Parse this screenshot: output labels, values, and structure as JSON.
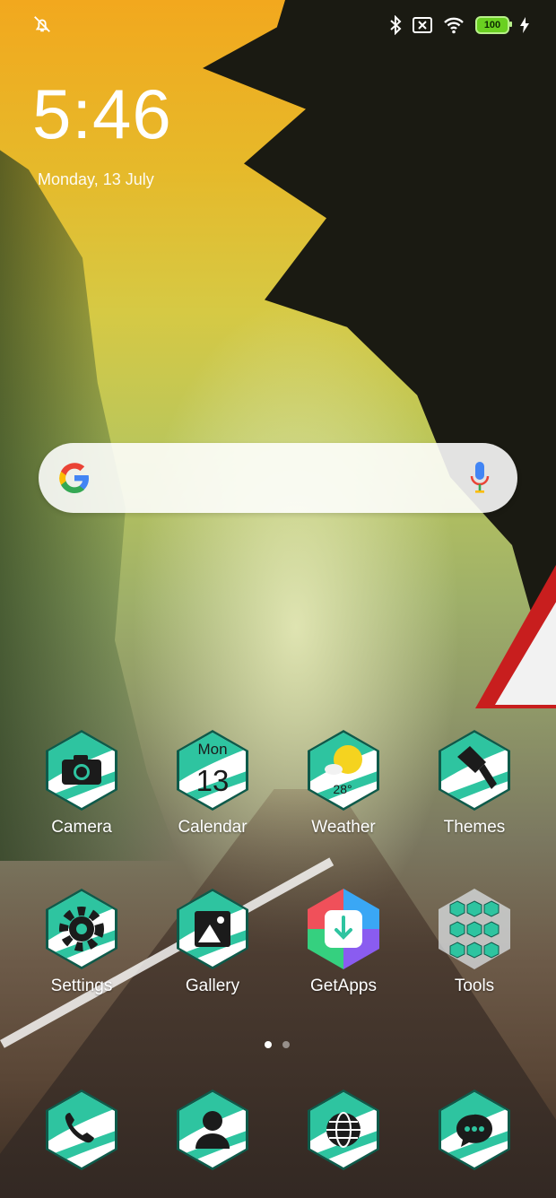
{
  "status_bar": {
    "battery_level": "100",
    "icons": [
      "alarm-off-icon",
      "bluetooth-icon",
      "no-sim-icon",
      "wifi-icon",
      "battery-icon",
      "charging-icon"
    ]
  },
  "lock_clock": {
    "time": "5:46",
    "date": "Monday, 13 July"
  },
  "search_widget": {
    "icons": [
      "google-logo-icon",
      "microphone-icon"
    ]
  },
  "apps": [
    {
      "label": "Camera",
      "icon": "camera-icon"
    },
    {
      "label": "Calendar",
      "icon": "calendar-icon",
      "day_name": "Mon",
      "day_number": "13"
    },
    {
      "label": "Weather",
      "icon": "weather-icon",
      "temperature": "28°"
    },
    {
      "label": "Themes",
      "icon": "paintbrush-icon"
    },
    {
      "label": "Settings",
      "icon": "gear-icon"
    },
    {
      "label": "Gallery",
      "icon": "image-icon"
    },
    {
      "label": "GetApps",
      "icon": "getapps-icon"
    },
    {
      "label": "Tools",
      "icon": "folder-icon"
    }
  ],
  "page_indicator": {
    "pages": 2,
    "current": 1
  },
  "dock": [
    {
      "icon": "phone-icon"
    },
    {
      "icon": "contacts-icon"
    },
    {
      "icon": "browser-globe-icon"
    },
    {
      "icon": "messages-icon"
    }
  ],
  "colors": {
    "hex_teal": "#2ec4a0",
    "hex_border": "#ffffff",
    "battery_green": "#6ad021"
  }
}
